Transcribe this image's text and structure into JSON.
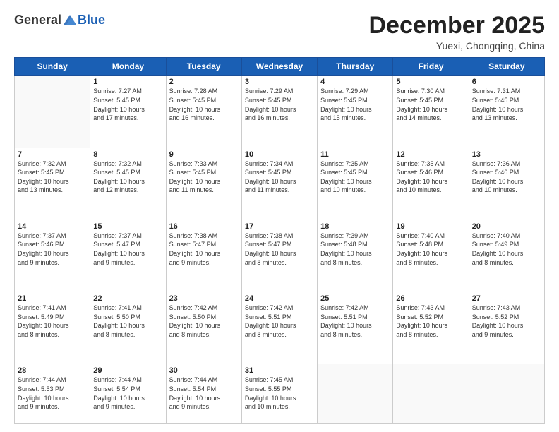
{
  "logo": {
    "general": "General",
    "blue": "Blue"
  },
  "header": {
    "month": "December 2025",
    "location": "Yuexi, Chongqing, China"
  },
  "days_of_week": [
    "Sunday",
    "Monday",
    "Tuesday",
    "Wednesday",
    "Thursday",
    "Friday",
    "Saturday"
  ],
  "weeks": [
    [
      {
        "day": "",
        "info": ""
      },
      {
        "day": "1",
        "info": "Sunrise: 7:27 AM\nSunset: 5:45 PM\nDaylight: 10 hours\nand 17 minutes."
      },
      {
        "day": "2",
        "info": "Sunrise: 7:28 AM\nSunset: 5:45 PM\nDaylight: 10 hours\nand 16 minutes."
      },
      {
        "day": "3",
        "info": "Sunrise: 7:29 AM\nSunset: 5:45 PM\nDaylight: 10 hours\nand 16 minutes."
      },
      {
        "day": "4",
        "info": "Sunrise: 7:29 AM\nSunset: 5:45 PM\nDaylight: 10 hours\nand 15 minutes."
      },
      {
        "day": "5",
        "info": "Sunrise: 7:30 AM\nSunset: 5:45 PM\nDaylight: 10 hours\nand 14 minutes."
      },
      {
        "day": "6",
        "info": "Sunrise: 7:31 AM\nSunset: 5:45 PM\nDaylight: 10 hours\nand 13 minutes."
      }
    ],
    [
      {
        "day": "7",
        "info": "Sunrise: 7:32 AM\nSunset: 5:45 PM\nDaylight: 10 hours\nand 13 minutes."
      },
      {
        "day": "8",
        "info": "Sunrise: 7:32 AM\nSunset: 5:45 PM\nDaylight: 10 hours\nand 12 minutes."
      },
      {
        "day": "9",
        "info": "Sunrise: 7:33 AM\nSunset: 5:45 PM\nDaylight: 10 hours\nand 11 minutes."
      },
      {
        "day": "10",
        "info": "Sunrise: 7:34 AM\nSunset: 5:45 PM\nDaylight: 10 hours\nand 11 minutes."
      },
      {
        "day": "11",
        "info": "Sunrise: 7:35 AM\nSunset: 5:45 PM\nDaylight: 10 hours\nand 10 minutes."
      },
      {
        "day": "12",
        "info": "Sunrise: 7:35 AM\nSunset: 5:46 PM\nDaylight: 10 hours\nand 10 minutes."
      },
      {
        "day": "13",
        "info": "Sunrise: 7:36 AM\nSunset: 5:46 PM\nDaylight: 10 hours\nand 10 minutes."
      }
    ],
    [
      {
        "day": "14",
        "info": "Sunrise: 7:37 AM\nSunset: 5:46 PM\nDaylight: 10 hours\nand 9 minutes."
      },
      {
        "day": "15",
        "info": "Sunrise: 7:37 AM\nSunset: 5:47 PM\nDaylight: 10 hours\nand 9 minutes."
      },
      {
        "day": "16",
        "info": "Sunrise: 7:38 AM\nSunset: 5:47 PM\nDaylight: 10 hours\nand 9 minutes."
      },
      {
        "day": "17",
        "info": "Sunrise: 7:38 AM\nSunset: 5:47 PM\nDaylight: 10 hours\nand 8 minutes."
      },
      {
        "day": "18",
        "info": "Sunrise: 7:39 AM\nSunset: 5:48 PM\nDaylight: 10 hours\nand 8 minutes."
      },
      {
        "day": "19",
        "info": "Sunrise: 7:40 AM\nSunset: 5:48 PM\nDaylight: 10 hours\nand 8 minutes."
      },
      {
        "day": "20",
        "info": "Sunrise: 7:40 AM\nSunset: 5:49 PM\nDaylight: 10 hours\nand 8 minutes."
      }
    ],
    [
      {
        "day": "21",
        "info": "Sunrise: 7:41 AM\nSunset: 5:49 PM\nDaylight: 10 hours\nand 8 minutes."
      },
      {
        "day": "22",
        "info": "Sunrise: 7:41 AM\nSunset: 5:50 PM\nDaylight: 10 hours\nand 8 minutes."
      },
      {
        "day": "23",
        "info": "Sunrise: 7:42 AM\nSunset: 5:50 PM\nDaylight: 10 hours\nand 8 minutes."
      },
      {
        "day": "24",
        "info": "Sunrise: 7:42 AM\nSunset: 5:51 PM\nDaylight: 10 hours\nand 8 minutes."
      },
      {
        "day": "25",
        "info": "Sunrise: 7:42 AM\nSunset: 5:51 PM\nDaylight: 10 hours\nand 8 minutes."
      },
      {
        "day": "26",
        "info": "Sunrise: 7:43 AM\nSunset: 5:52 PM\nDaylight: 10 hours\nand 8 minutes."
      },
      {
        "day": "27",
        "info": "Sunrise: 7:43 AM\nSunset: 5:52 PM\nDaylight: 10 hours\nand 9 minutes."
      }
    ],
    [
      {
        "day": "28",
        "info": "Sunrise: 7:44 AM\nSunset: 5:53 PM\nDaylight: 10 hours\nand 9 minutes."
      },
      {
        "day": "29",
        "info": "Sunrise: 7:44 AM\nSunset: 5:54 PM\nDaylight: 10 hours\nand 9 minutes."
      },
      {
        "day": "30",
        "info": "Sunrise: 7:44 AM\nSunset: 5:54 PM\nDaylight: 10 hours\nand 9 minutes."
      },
      {
        "day": "31",
        "info": "Sunrise: 7:45 AM\nSunset: 5:55 PM\nDaylight: 10 hours\nand 10 minutes."
      },
      {
        "day": "",
        "info": ""
      },
      {
        "day": "",
        "info": ""
      },
      {
        "day": "",
        "info": ""
      }
    ]
  ]
}
